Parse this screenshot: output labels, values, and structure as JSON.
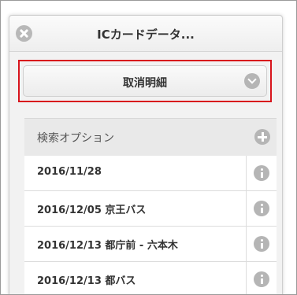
{
  "header": {
    "title": "ICカードデータ..."
  },
  "receipt_select": {
    "label": "取消明細"
  },
  "search_options": {
    "label": "検索オプション"
  },
  "records": [
    {
      "text": "2016/11/28"
    },
    {
      "text": "2016/12/05 京王バス"
    },
    {
      "text": "2016/12/13 都庁前 - 六本木"
    },
    {
      "text": "2016/12/13 都バス"
    }
  ],
  "colors": {
    "highlight_border": "#d8141c",
    "icon_gray": "#b5b5b5"
  },
  "icons": {
    "close": "close-icon",
    "select": "chevron-down-icon",
    "search": "plus-icon",
    "info": "info-icon"
  }
}
